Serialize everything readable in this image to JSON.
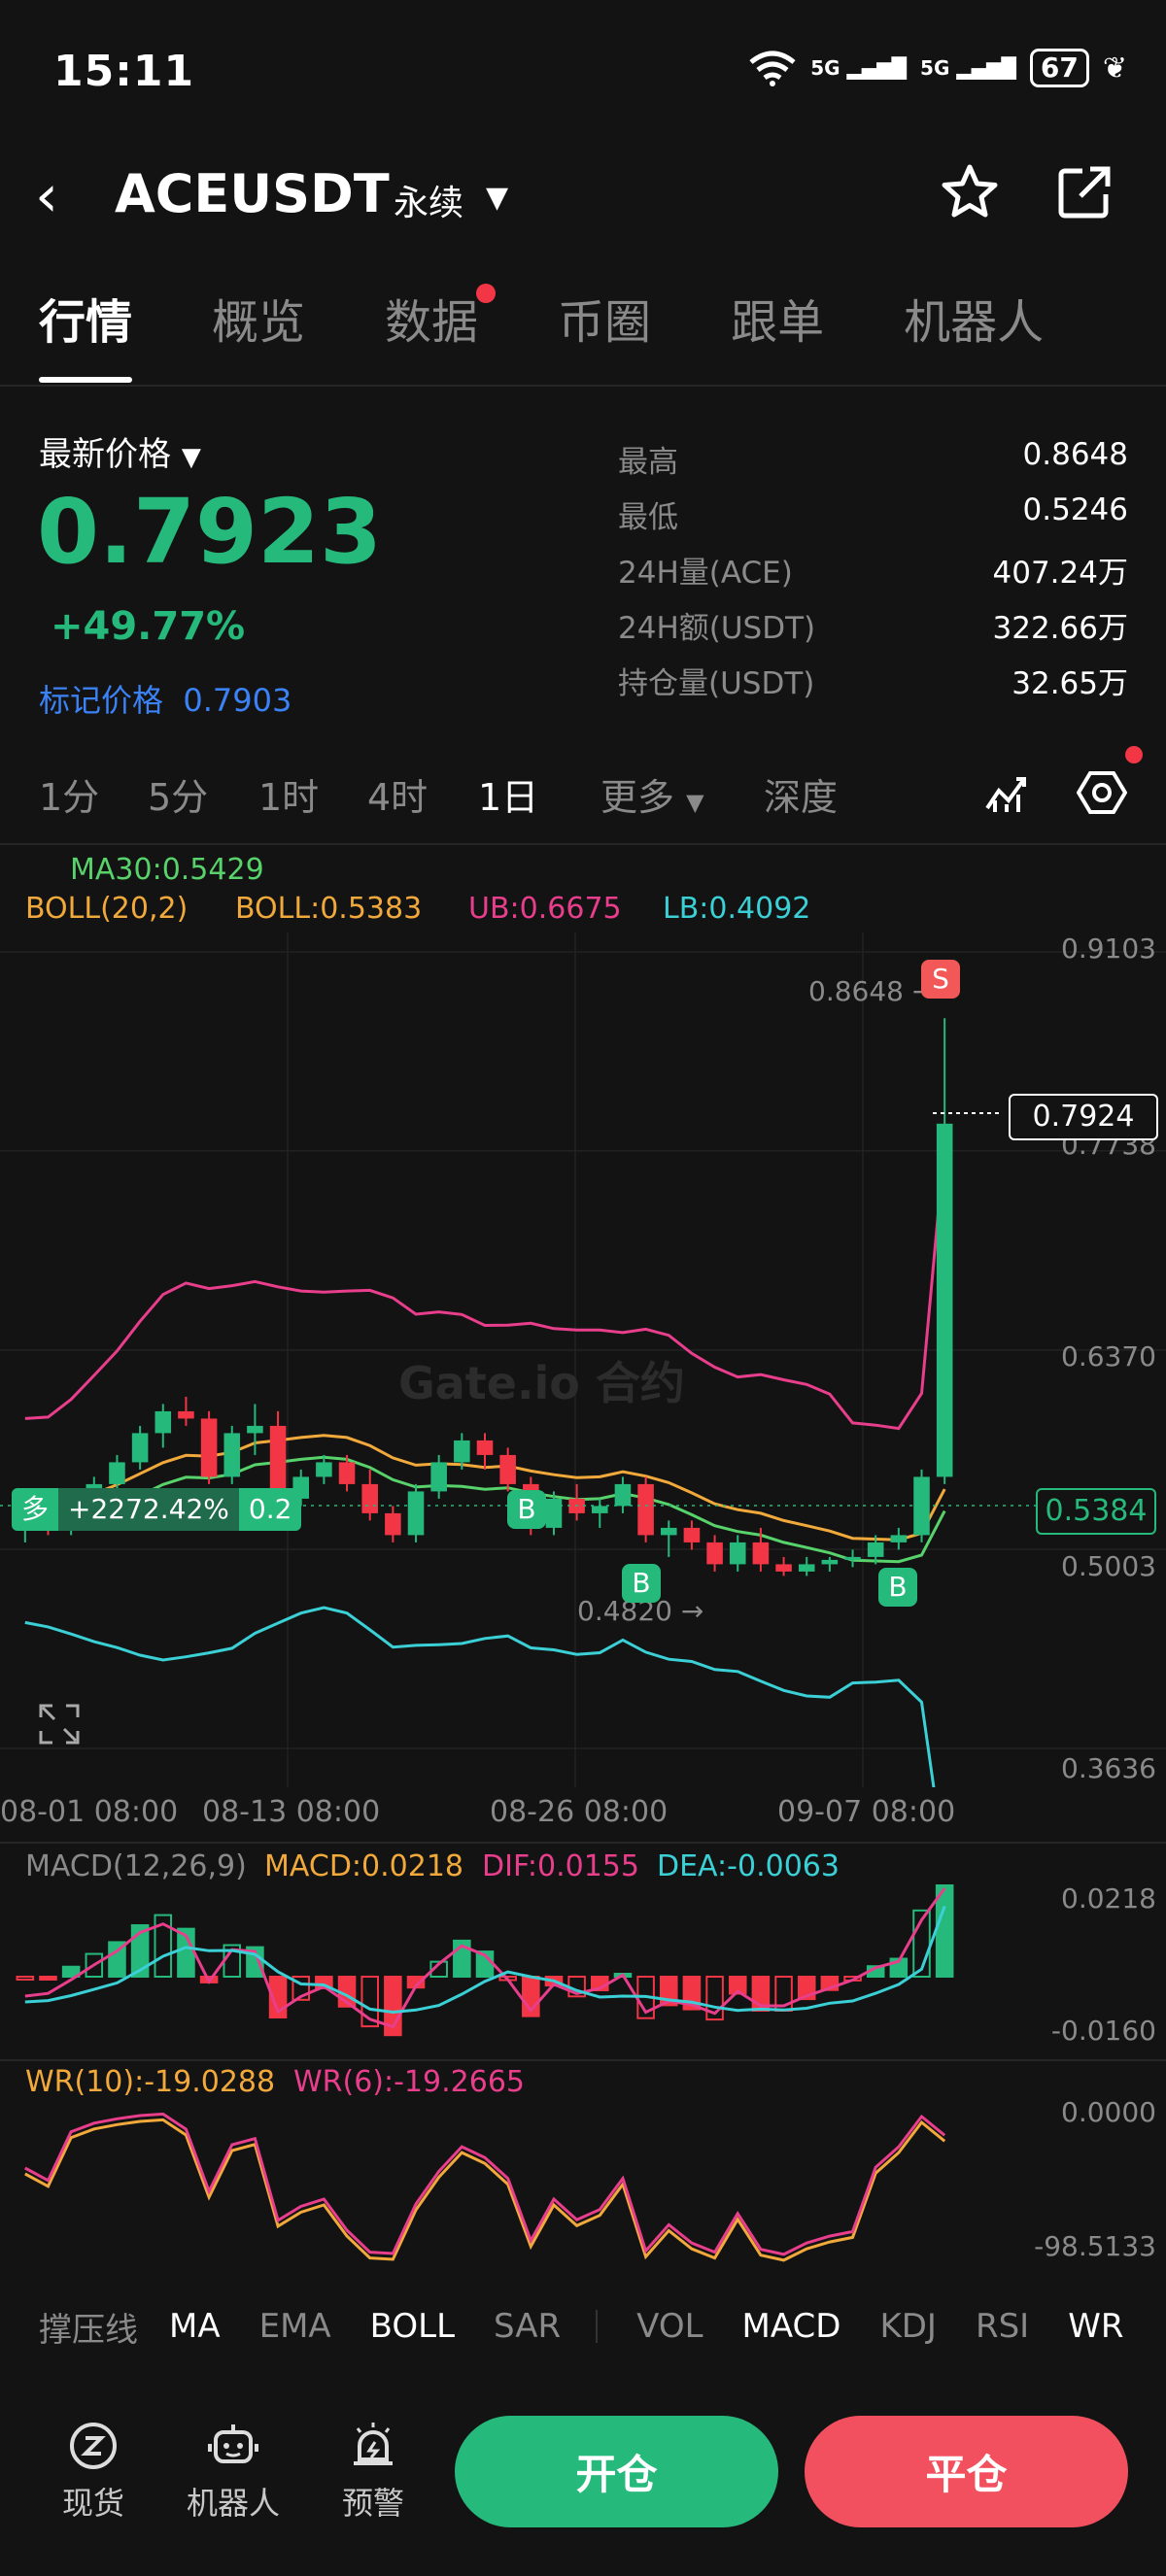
{
  "status_bar": {
    "time": "15:11",
    "battery": "67",
    "net1": "5G",
    "net2": "5G"
  },
  "header": {
    "symbol": "ACEUSDT",
    "contract_type": "永续"
  },
  "tabs": [
    {
      "label": "行情",
      "active": true
    },
    {
      "label": "概览",
      "active": false
    },
    {
      "label": "数据",
      "active": false,
      "badge": true
    },
    {
      "label": "币圈",
      "active": false
    },
    {
      "label": "跟单",
      "active": false
    },
    {
      "label": "机器人",
      "active": false
    }
  ],
  "price": {
    "label": "最新价格",
    "last": "0.7923",
    "change_pct": "+49.77%",
    "mark_label": "标记价格",
    "mark_value": "0.7903"
  },
  "stats": [
    {
      "label": "最高",
      "value": "0.8648"
    },
    {
      "label": "最低",
      "value": "0.5246"
    },
    {
      "label": "24H量(ACE)",
      "value": "407.24万"
    },
    {
      "label": "24H额(USDT)",
      "value": "322.66万"
    },
    {
      "label": "持仓量(USDT)",
      "value": "32.65万"
    }
  ],
  "timeframes": [
    {
      "label": "1分",
      "active": false
    },
    {
      "label": "5分",
      "active": false
    },
    {
      "label": "1时",
      "active": false
    },
    {
      "label": "4时",
      "active": false
    },
    {
      "label": "1日",
      "active": true
    },
    {
      "label": "更多",
      "active": false
    },
    {
      "label": "深度",
      "active": false
    }
  ],
  "colors": {
    "up": "#26b97c",
    "down": "#f23645",
    "ma30": "#58d26b",
    "boll": "#f2a93b",
    "ub": "#e83e8c",
    "lb": "#3bd0d6"
  },
  "main_legend": {
    "ma30": "MA30:0.5429",
    "boll_params": "BOLL(20,2)",
    "boll": "BOLL:0.5383",
    "ub": "UB:0.6675",
    "lb": "LB:0.4092"
  },
  "main_axis": [
    "0.9103",
    "0.7738",
    "0.6370",
    "0.5003",
    "0.3636"
  ],
  "date_ticks": [
    "08-01 08:00",
    "08-13 08:00",
    "08-26 08:00",
    "09-07 08:00"
  ],
  "price_tags": {
    "current": "0.7924",
    "boll_mid": "0.5384",
    "high": "0.8648",
    "low": "0.4820"
  },
  "position_tag": {
    "side": "多",
    "pnl": "+2272.42%",
    "size": "0.2"
  },
  "trade_markers": {
    "buy": "B",
    "sell": "S"
  },
  "watermark": "Gate.io 合约",
  "macd_legend": {
    "params": "MACD(12,26,9)",
    "macd": "MACD:0.0218",
    "dif": "DIF:0.0155",
    "dea": "DEA:-0.0063"
  },
  "macd_axis": [
    "0.0218",
    "-0.0160"
  ],
  "wr_legend": {
    "wr10": "WR(10):-19.0288",
    "wr6": "WR(6):-19.2665"
  },
  "wr_axis": [
    "0.0000",
    "-98.5133"
  ],
  "indicators": [
    {
      "label": "撑压线",
      "on": false
    },
    {
      "label": "MA",
      "on": true
    },
    {
      "label": "EMA",
      "on": false
    },
    {
      "label": "BOLL",
      "on": true
    },
    {
      "label": "SAR",
      "on": false
    },
    {
      "label": "VOL",
      "on": false
    },
    {
      "label": "MACD",
      "on": true
    },
    {
      "label": "KDJ",
      "on": false
    },
    {
      "label": "RSI",
      "on": false
    },
    {
      "label": "WR",
      "on": true
    }
  ],
  "bottom_nav": [
    {
      "label": "现货",
      "icon": "spot-icon"
    },
    {
      "label": "机器人",
      "icon": "robot-icon"
    },
    {
      "label": "预警",
      "icon": "alert-icon"
    }
  ],
  "actions": {
    "open": "开仓",
    "close": "平仓"
  },
  "chart_data": {
    "type": "candlestick",
    "interval": "1日",
    "ylim": [
      0.3636,
      0.9103
    ],
    "candles_ohlc": [
      [
        0.515,
        0.53,
        0.505,
        0.52
      ],
      [
        0.52,
        0.53,
        0.51,
        0.518
      ],
      [
        0.518,
        0.535,
        0.51,
        0.53
      ],
      [
        0.53,
        0.55,
        0.52,
        0.545
      ],
      [
        0.545,
        0.565,
        0.54,
        0.56
      ],
      [
        0.56,
        0.585,
        0.555,
        0.58
      ],
      [
        0.58,
        0.6,
        0.57,
        0.595
      ],
      [
        0.595,
        0.605,
        0.585,
        0.59
      ],
      [
        0.59,
        0.595,
        0.545,
        0.55
      ],
      [
        0.55,
        0.585,
        0.545,
        0.58
      ],
      [
        0.58,
        0.6,
        0.565,
        0.585
      ],
      [
        0.585,
        0.595,
        0.53,
        0.535
      ],
      [
        0.535,
        0.555,
        0.53,
        0.55
      ],
      [
        0.55,
        0.565,
        0.545,
        0.56
      ],
      [
        0.56,
        0.565,
        0.54,
        0.545
      ],
      [
        0.545,
        0.555,
        0.52,
        0.525
      ],
      [
        0.525,
        0.53,
        0.505,
        0.51
      ],
      [
        0.51,
        0.545,
        0.505,
        0.54
      ],
      [
        0.54,
        0.565,
        0.535,
        0.56
      ],
      [
        0.56,
        0.58,
        0.555,
        0.575
      ],
      [
        0.575,
        0.58,
        0.555,
        0.565
      ],
      [
        0.565,
        0.57,
        0.54,
        0.545
      ],
      [
        0.545,
        0.55,
        0.51,
        0.515
      ],
      [
        0.515,
        0.54,
        0.51,
        0.535
      ],
      [
        0.535,
        0.545,
        0.52,
        0.525
      ],
      [
        0.525,
        0.535,
        0.515,
        0.53
      ],
      [
        0.53,
        0.55,
        0.525,
        0.545
      ],
      [
        0.545,
        0.55,
        0.505,
        0.51
      ],
      [
        0.51,
        0.52,
        0.495,
        0.515
      ],
      [
        0.515,
        0.52,
        0.5,
        0.505
      ],
      [
        0.505,
        0.51,
        0.485,
        0.49
      ],
      [
        0.49,
        0.51,
        0.485,
        0.505
      ],
      [
        0.505,
        0.515,
        0.485,
        0.49
      ],
      [
        0.49,
        0.495,
        0.482,
        0.485
      ],
      [
        0.485,
        0.495,
        0.482,
        0.49
      ],
      [
        0.49,
        0.495,
        0.485,
        0.493
      ],
      [
        0.493,
        0.5,
        0.488,
        0.495
      ],
      [
        0.495,
        0.51,
        0.49,
        0.505
      ],
      [
        0.505,
        0.515,
        0.5,
        0.51
      ],
      [
        0.51,
        0.555,
        0.505,
        0.55
      ],
      [
        0.55,
        0.8648,
        0.545,
        0.7924
      ]
    ],
    "high_marker": 0.8648,
    "low_marker": 0.482,
    "current_price": 0.7924
  }
}
